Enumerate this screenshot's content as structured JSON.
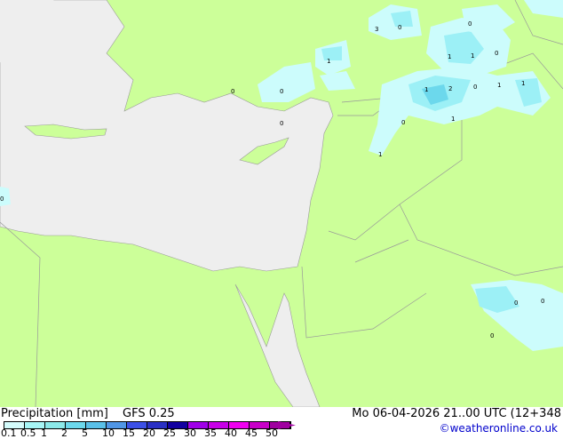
{
  "title": "Precipitation [mm]",
  "model": "GFS 0.25",
  "datetime": "Mo 06-04-2026 21..00 UTC (12+348",
  "credit": "©weatheronline.co.uk",
  "legend": {
    "ticks": [
      "0.1",
      "0.5",
      "1",
      "2",
      "5",
      "10",
      "15",
      "20",
      "25",
      "30",
      "35",
      "40",
      "45",
      "50"
    ],
    "colors": [
      "#d4fcfc",
      "#a6f6f6",
      "#8ceaea",
      "#6cd8ec",
      "#5ac0e8",
      "#5096e6",
      "#3c50e6",
      "#2a30c4",
      "#1200a0",
      "#a000e8",
      "#c800e8",
      "#f000f0",
      "#c800c8",
      "#a000a0"
    ]
  },
  "colors": {
    "land": "#ccff99",
    "sea": "#eeeeee",
    "border": "#999999",
    "precip_light": "#ccfcfc",
    "precip_mid": "#9cf0f6",
    "precip_heavy": "#6cd8ec"
  },
  "map_labels": [
    "3",
    "0",
    "1",
    "0",
    "0",
    "1",
    "0",
    "1",
    "2",
    "0",
    "1",
    "1",
    "0",
    "0",
    "1",
    "1",
    "0",
    "0",
    "1",
    "0",
    "0",
    "0"
  ]
}
